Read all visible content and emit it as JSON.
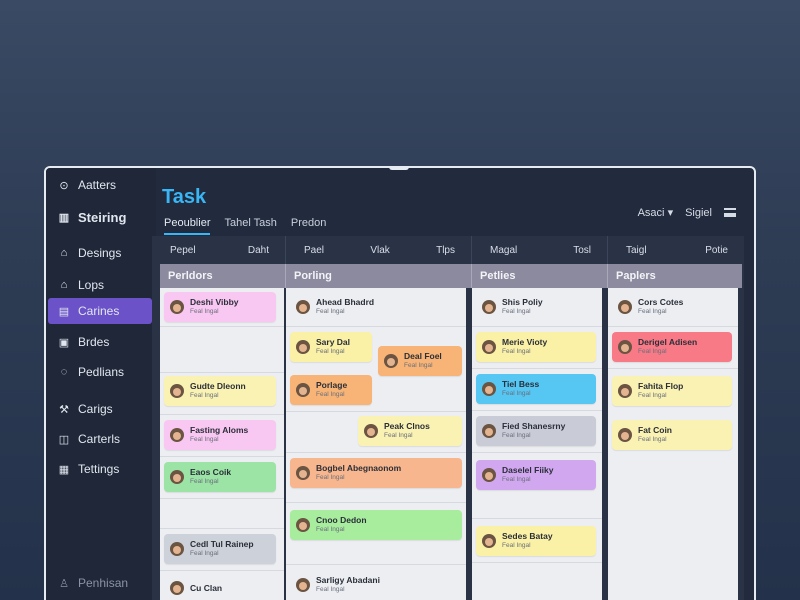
{
  "app": {
    "name": "Aatters"
  },
  "sidebar": {
    "items": [
      {
        "label": "Aatters",
        "icon": "compass-icon"
      },
      {
        "label": "Steiring",
        "icon": "grid-icon"
      },
      {
        "label": "Desings",
        "icon": "home-icon"
      },
      {
        "label": "Lops",
        "icon": "home-outline-icon"
      },
      {
        "label": "Carines",
        "icon": "folder-icon",
        "active": true
      },
      {
        "label": "Brdes",
        "icon": "board-icon"
      },
      {
        "label": "Pedlians",
        "icon": "chat-icon"
      },
      {
        "label": "Carigs",
        "icon": "wrench-icon"
      },
      {
        "label": "Carterls",
        "icon": "layout-icon"
      },
      {
        "label": "Tettings",
        "icon": "calendar-icon"
      },
      {
        "label": "Penhisan",
        "icon": "user-icon"
      }
    ]
  },
  "header": {
    "title": "Task",
    "tabs": [
      {
        "label": "Peoublier",
        "active": true
      },
      {
        "label": "Tahel Tash"
      },
      {
        "label": "Predon"
      }
    ],
    "right": {
      "user": "Asaci",
      "chevron": "▾",
      "signal": "Sigiel",
      "menu_icon": "hamburger-icon"
    }
  },
  "board": {
    "column_headers": [
      [
        "Pepel",
        "Daht"
      ],
      [
        "Pael",
        "Vlak",
        "Tlps"
      ],
      [
        "Magal",
        "Tosl"
      ],
      [
        "Taigl",
        "Potie"
      ]
    ],
    "groups": [
      "Perldors",
      "Porling",
      "Petlies",
      "Paplers"
    ],
    "cards": {
      "col1": [
        {
          "title": "Deshi Vibby",
          "sub": "Feal Ingal",
          "color": "#f9c8f2"
        },
        {
          "title": "Gudte Dleonn",
          "sub": "Feal Ingal",
          "color": "#faf2b3"
        },
        {
          "title": "Fasting Aloms",
          "sub": "Feal Ingal",
          "color": "#f9c8f2"
        },
        {
          "title": "Eaos Coik",
          "sub": "Feal Ingal",
          "color": "#9ce3a6"
        },
        {
          "title": "Cedl Tul Rainep",
          "sub": "Feal Ingal",
          "color": "#cdd1d9"
        },
        {
          "title": "Cu Clan",
          "sub": "",
          "color": "#eceef2"
        }
      ],
      "col2": [
        {
          "title": "Ahead Bhadrd",
          "sub": "Feal Ingal",
          "color": "#eceef2"
        },
        {
          "title": "Sary Dal",
          "sub": "Feal Ingal",
          "color": "#faf0a6"
        },
        {
          "title": "Deal Foel",
          "sub": "Feal Ingal",
          "color": "#f7b476"
        },
        {
          "title": "Porlage",
          "sub": "Feal Ingal",
          "color": "#f7b476"
        },
        {
          "title": "Peak Clnos",
          "sub": "Feal Ingal",
          "color": "#faf2b3"
        },
        {
          "title": "Bogbel Abegnaonom",
          "sub": "Feal Ingal",
          "color": "#f7b68d"
        },
        {
          "title": "Cnoo Dedon",
          "sub": "Feal Ingal",
          "color": "#a8ec9e"
        },
        {
          "title": "Sarligy Abadani",
          "sub": "Feal Ingal",
          "color": "#eceef2"
        }
      ],
      "col3": [
        {
          "title": "Shis Poliy",
          "sub": "Feal Ingal",
          "color": "#eceef2"
        },
        {
          "title": "Merie Vioty",
          "sub": "Feal Ingal",
          "color": "#faf0a6"
        },
        {
          "title": "Tiel Bess",
          "sub": "Feal Ingal",
          "color": "#56c6f2"
        },
        {
          "title": "Fied Shanesrny",
          "sub": "Feal Ingal",
          "color": "#c9ccd6"
        },
        {
          "title": "Daselel Fiiky",
          "sub": "Feal Ingal",
          "color": "#d1a8ef"
        },
        {
          "title": "Sedes Batay",
          "sub": "Feal Ingal",
          "color": "#faf0a6"
        }
      ],
      "col4": [
        {
          "title": "Cors Cotes",
          "sub": "Feal Ingal",
          "color": "#eceef2"
        },
        {
          "title": "Derigel Adisen",
          "sub": "Feal Ingal",
          "color": "#f77a86"
        },
        {
          "title": "Fahita Flop",
          "sub": "Feal Ingal",
          "color": "#faf2b3"
        },
        {
          "title": "Fat Coin",
          "sub": "Feal Ingal",
          "color": "#faf2b3"
        }
      ]
    }
  }
}
